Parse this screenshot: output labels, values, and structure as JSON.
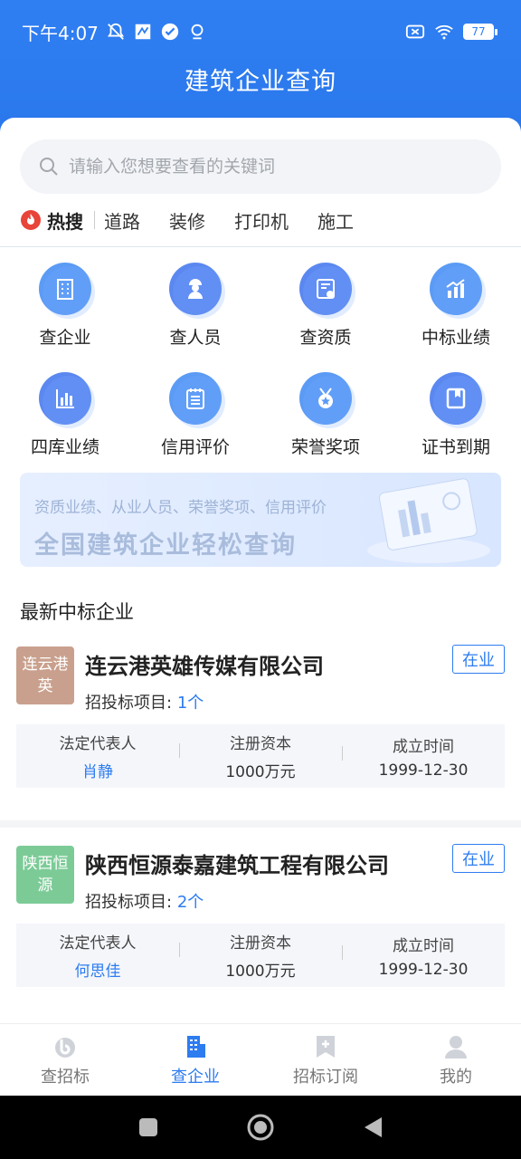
{
  "status_bar": {
    "time": "下午4:07",
    "battery": "77"
  },
  "header": {
    "title": "建筑企业查询"
  },
  "search": {
    "placeholder": "请输入您想要查看的关键词"
  },
  "hot": {
    "label": "热搜",
    "items": [
      "道路",
      "装修",
      "打印机",
      "施工"
    ]
  },
  "grid": [
    {
      "label": "查企业",
      "icon": "building-icon"
    },
    {
      "label": "查人员",
      "icon": "person-icon"
    },
    {
      "label": "查资质",
      "icon": "certificate-icon"
    },
    {
      "label": "中标业绩",
      "icon": "growth-chart-icon"
    },
    {
      "label": "四库业绩",
      "icon": "bar-chart-icon"
    },
    {
      "label": "信用评价",
      "icon": "notepad-icon"
    },
    {
      "label": "荣誉奖项",
      "icon": "medal-icon"
    },
    {
      "label": "证书到期",
      "icon": "bookmark-icon"
    }
  ],
  "banner": {
    "subtitle": "资质业绩、从业人员、荣誉奖项、信用评价",
    "title": "全国建筑企业轻松查询"
  },
  "section": {
    "title": "最新中标企业"
  },
  "companies": [
    {
      "avatar": "连云港英",
      "avatar_color": "#c9a08d",
      "name": "连云港英雄传媒有限公司",
      "status": "在业",
      "project_label": "招投标项目:",
      "project_count": "1个",
      "legal_label": "法定代表人",
      "legal": "肖静",
      "capital_label": "注册资本",
      "capital": "1000万元",
      "date_label": "成立时间",
      "date": "1999-12-30"
    },
    {
      "avatar": "陕西恒源",
      "avatar_color": "#7ccb97",
      "name": "陕西恒源泰嘉建筑工程有限公司",
      "status": "在业",
      "project_label": "招投标项目:",
      "project_count": "2个",
      "legal_label": "法定代表人",
      "legal": "何思佳",
      "capital_label": "注册资本",
      "capital": "1000万元",
      "date_label": "成立时间",
      "date": "1999-12-30"
    }
  ],
  "bottom_nav": [
    {
      "label": "查招标",
      "icon": "bid-icon",
      "active": false
    },
    {
      "label": "查企业",
      "icon": "company-icon",
      "active": true
    },
    {
      "label": "招标订阅",
      "icon": "subscribe-icon",
      "active": false
    },
    {
      "label": "我的",
      "icon": "user-icon",
      "active": false
    }
  ],
  "colors": {
    "primary": "#2d7cf0",
    "icon_fill": "#5b9bf5"
  }
}
